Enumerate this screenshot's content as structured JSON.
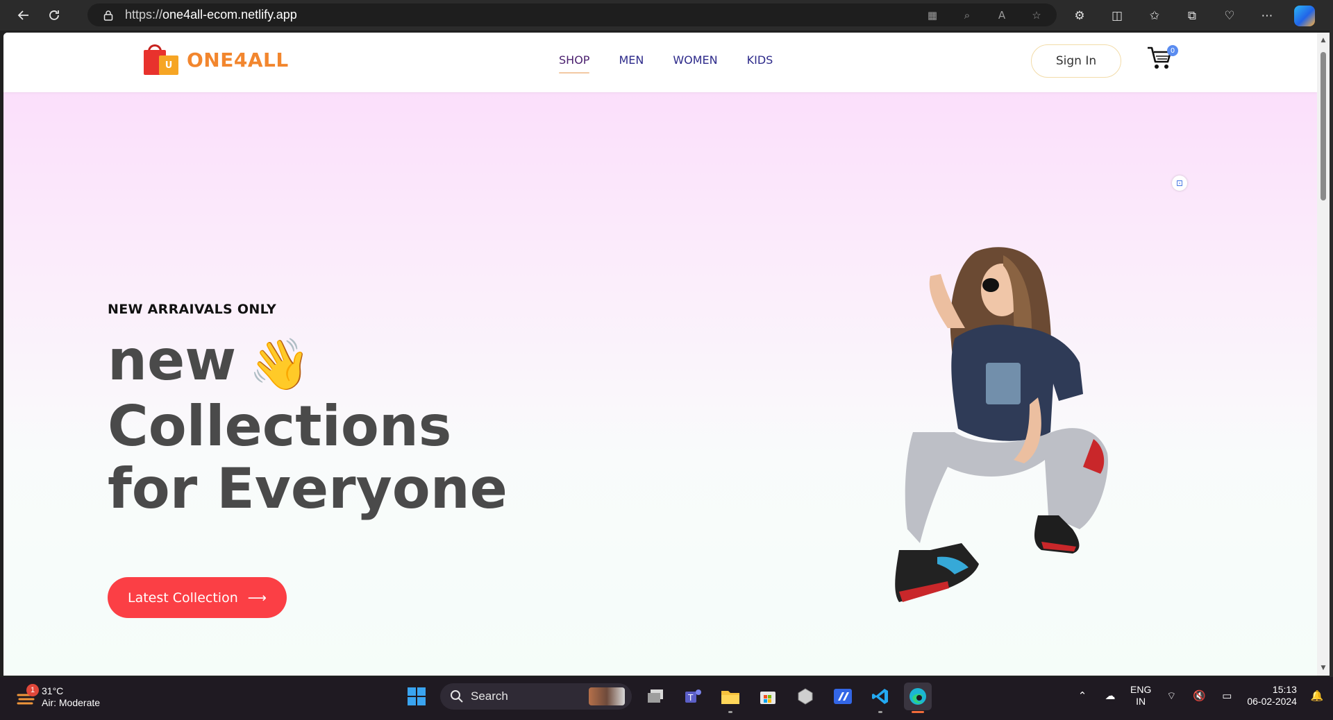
{
  "browser": {
    "url_scheme": "https://",
    "url_host": "one4all-ecom.netlify.app",
    "icons": [
      "back-icon",
      "refresh-icon",
      "lock-icon",
      "apps-icon",
      "zoom-icon",
      "read-aloud-icon",
      "favorite-icon",
      "extensions-icon",
      "split-screen-icon",
      "favorites-icon",
      "collections-icon",
      "performance-icon",
      "more-icon",
      "copilot-icon"
    ]
  },
  "site": {
    "logo_text": "ONE4ALL",
    "logo_badge": "U",
    "nav": [
      {
        "label": "SHOP",
        "active": true
      },
      {
        "label": "MEN",
        "active": false
      },
      {
        "label": "WOMEN",
        "active": false
      },
      {
        "label": "KIDS",
        "active": false
      }
    ],
    "signin_label": "Sign In",
    "cart_count": "0"
  },
  "hero": {
    "eyebrow": "NEW ARRAIVALS ONLY",
    "line1": "new",
    "line2": "Collections",
    "line3": "for Everyone",
    "emoji": "👋",
    "cta_label": "Latest Collection",
    "cta_arrow": "⟶"
  },
  "taskbar": {
    "weather_temp": "31°C",
    "weather_desc": "Air: Moderate",
    "weather_badge": "1",
    "search_label": "Search",
    "lang_line1": "ENG",
    "lang_line2": "IN",
    "time": "15:13",
    "date": "06-02-2024"
  },
  "colors": {
    "accent_red": "#fb3f45",
    "logo_orange": "#f2862e",
    "nav_blue": "#2d2a8a",
    "hero_text": "#4a4a4a"
  }
}
